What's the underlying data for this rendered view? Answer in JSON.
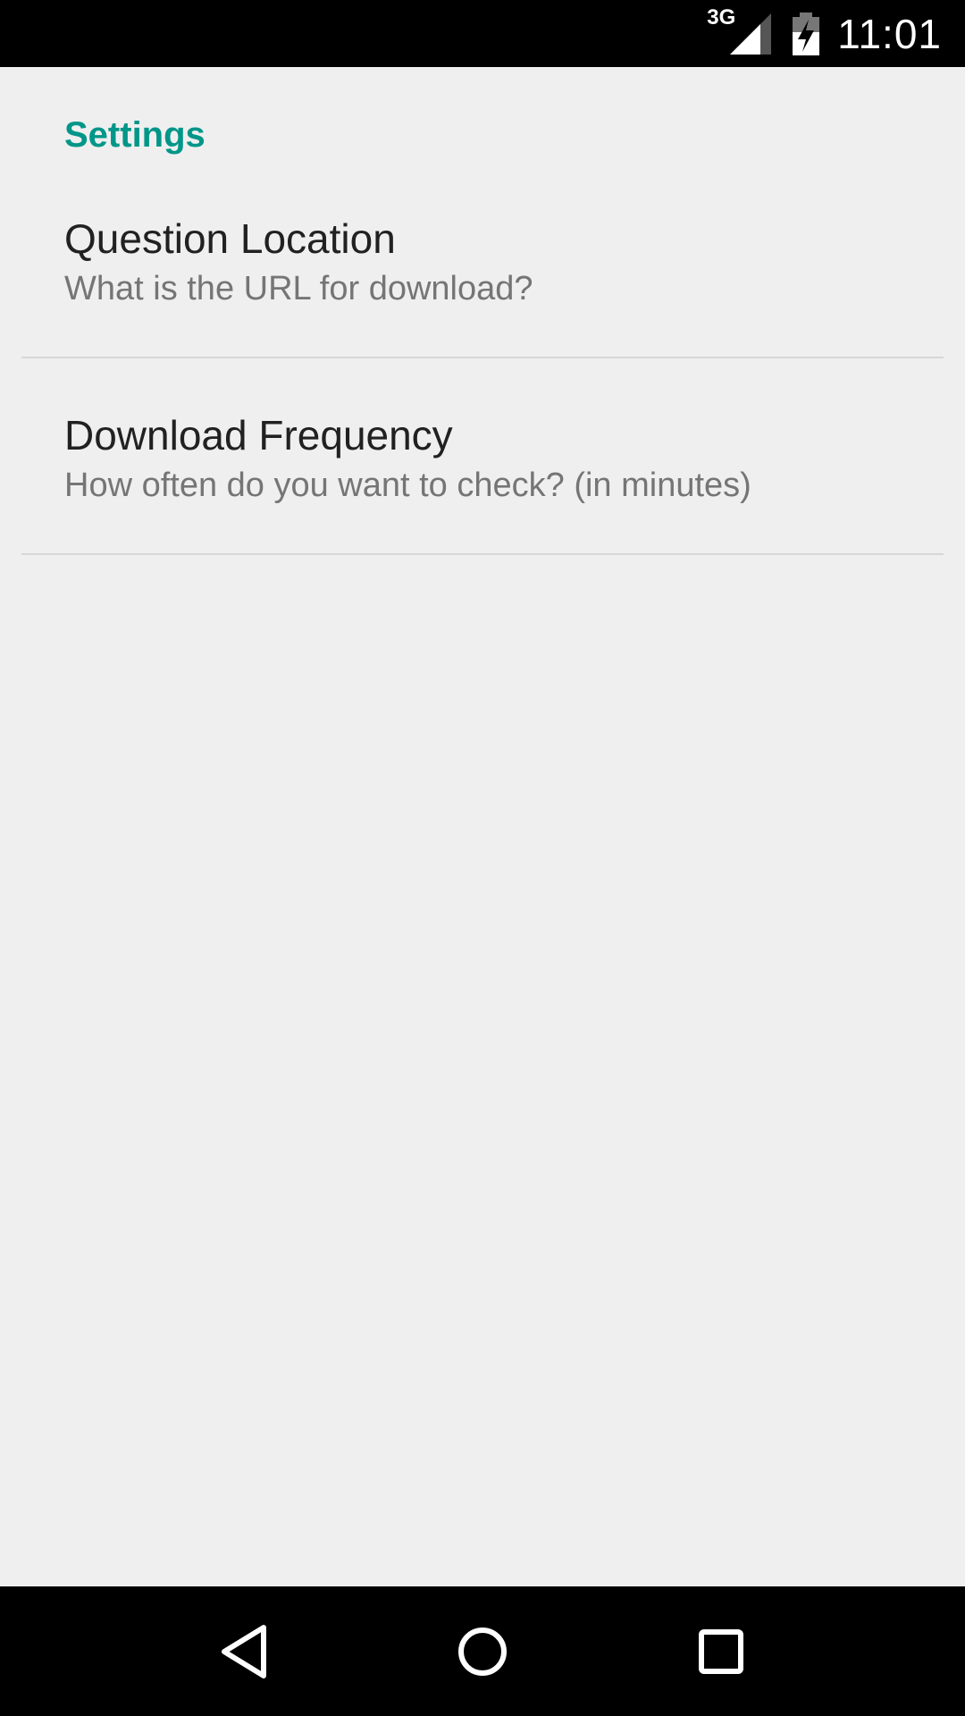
{
  "status_bar": {
    "network": "3G",
    "time": "11:01",
    "icons": [
      "signal-icon",
      "battery-charging-icon"
    ]
  },
  "settings": {
    "category_title": "Settings",
    "items": [
      {
        "title": "Question Location",
        "summary": "What is the URL for download?"
      },
      {
        "title": "Download Frequency",
        "summary": "How often do you want to check? (in minutes)"
      }
    ]
  },
  "nav_bar": {
    "icons": [
      "back-icon",
      "home-icon",
      "recents-icon"
    ]
  },
  "colors": {
    "accent": "#009688",
    "background": "#efefef",
    "title_text": "#212121",
    "summary_text": "#757575"
  }
}
